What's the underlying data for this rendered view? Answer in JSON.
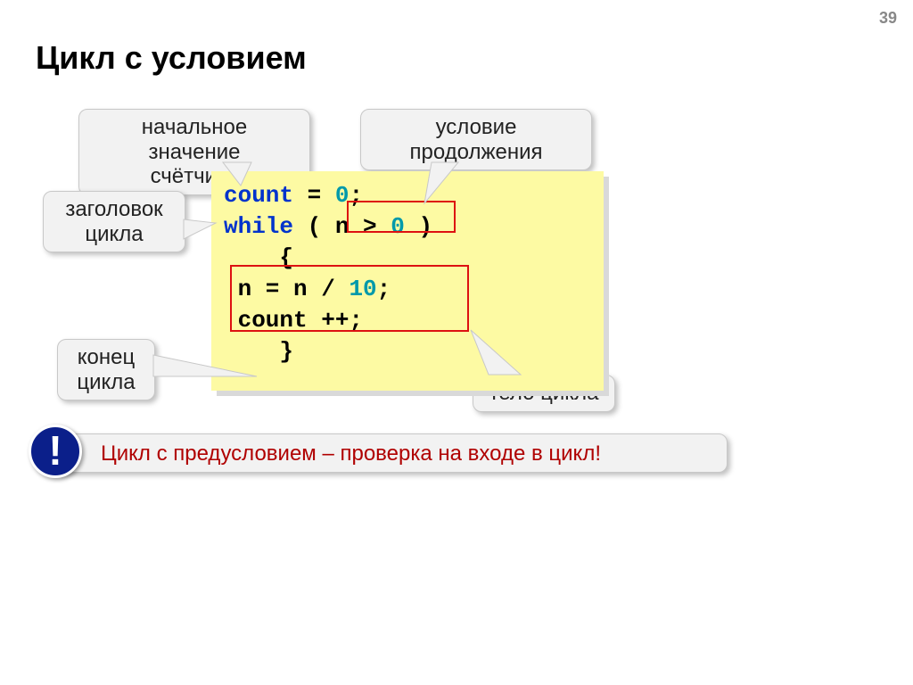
{
  "page_number": "39",
  "title": "Цикл с условием",
  "labels": {
    "initial": "начальное значение\nсчётчика",
    "condition": "условие\nпродолжения",
    "header": "заголовок\nцикла",
    "end": "конец\nцикла",
    "body": "тело цикла"
  },
  "code": {
    "l1a": "count",
    "l1b": " = ",
    "l1c": "0",
    "l1d": ";",
    "l2a": "while",
    "l2b": " ( ",
    "l2c": "n > ",
    "l2d": "0",
    "l2e": " )",
    "l3": "    {",
    "l4a": " n = n / ",
    "l4b": "10",
    "l4c": ";",
    "l5": " count ++;",
    "l6": "    }"
  },
  "note": "Цикл с предусловием – проверка на входе в цикл!",
  "bang": "!"
}
